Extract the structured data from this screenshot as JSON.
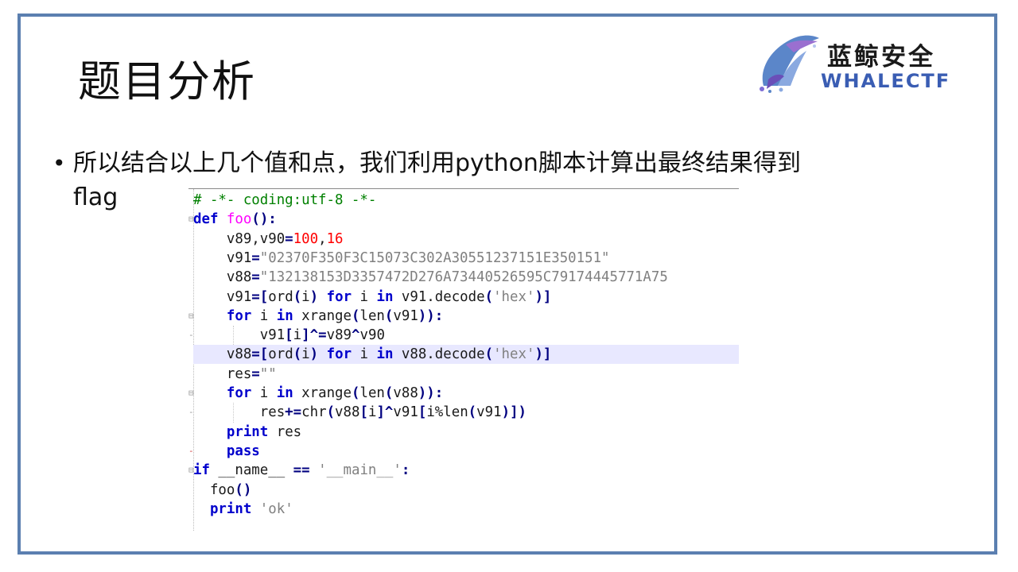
{
  "slide": {
    "title": "题目分析",
    "logo": {
      "cn": "蓝鲸安全",
      "en": "WHALECTF",
      "accent_color": "#3a5db3",
      "icon": "whale-logo-icon"
    },
    "bullet": {
      "line1": "所以结合以上几个值和点，我们利用python脚本计算出最终结果得到",
      "line2": "flag"
    },
    "frame_color": "#5b7fb0"
  },
  "code": {
    "lines": [
      "# -*- coding:utf-8 -*-",
      "def foo():",
      "    v89,v90=100,16",
      "    v91=\"02370F350F3C15073C302A30551237151E350151\"",
      "    v88=\"132138153D3357472D276A73440526595C79174445771A75",
      "    v91=[ord(i) for i in v91.decode('hex')]",
      "    for i in xrange(len(v91)):",
      "        v91[i]^=v89^v90",
      "    v88=[ord(i) for i in v88.decode('hex')]",
      "    res=\"\"",
      "    for i in xrange(len(v88)):",
      "        res+=chr(v88[i]^v91[i%len(v91)])",
      "    print res",
      "    pass",
      "if __name__ == '__main__':",
      "  foo()",
      "  print 'ok'"
    ],
    "highlighted_line": 8,
    "colors": {
      "comment": "#008000",
      "keyword": "#0000cc",
      "function": "#ff00ff",
      "number": "#ff0000",
      "string": "#808080",
      "highlight": "#e8e8ff"
    }
  }
}
